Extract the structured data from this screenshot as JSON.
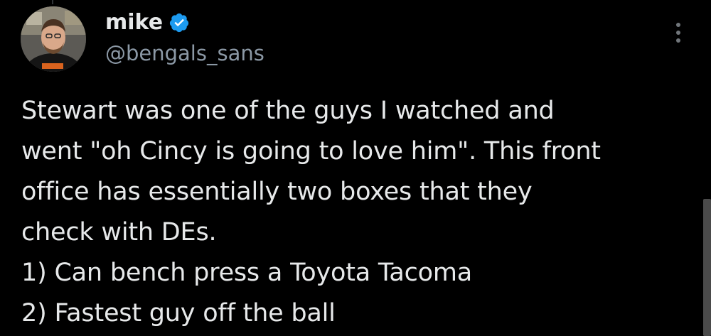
{
  "author": {
    "display_name": "mike",
    "handle": "@bengals_sans",
    "verified": true,
    "avatar_icon": "profile-photo"
  },
  "colors": {
    "background": "#000000",
    "text": "#e7e9ea",
    "secondary_text": "#8b98a5",
    "verified_badge": "#1d9bf0"
  },
  "tweet": {
    "lines": [
      "Stewart was one of the guys I watched and",
      "went \"oh Cincy is going to love him\". This front",
      "office has essentially two boxes that they",
      "check with DEs.",
      "1) Can bench press a Toyota Tacoma",
      "2) Fastest guy off the ball"
    ]
  },
  "icons": {
    "more": "more-vertical-icon",
    "verified": "verified-badge-icon"
  }
}
